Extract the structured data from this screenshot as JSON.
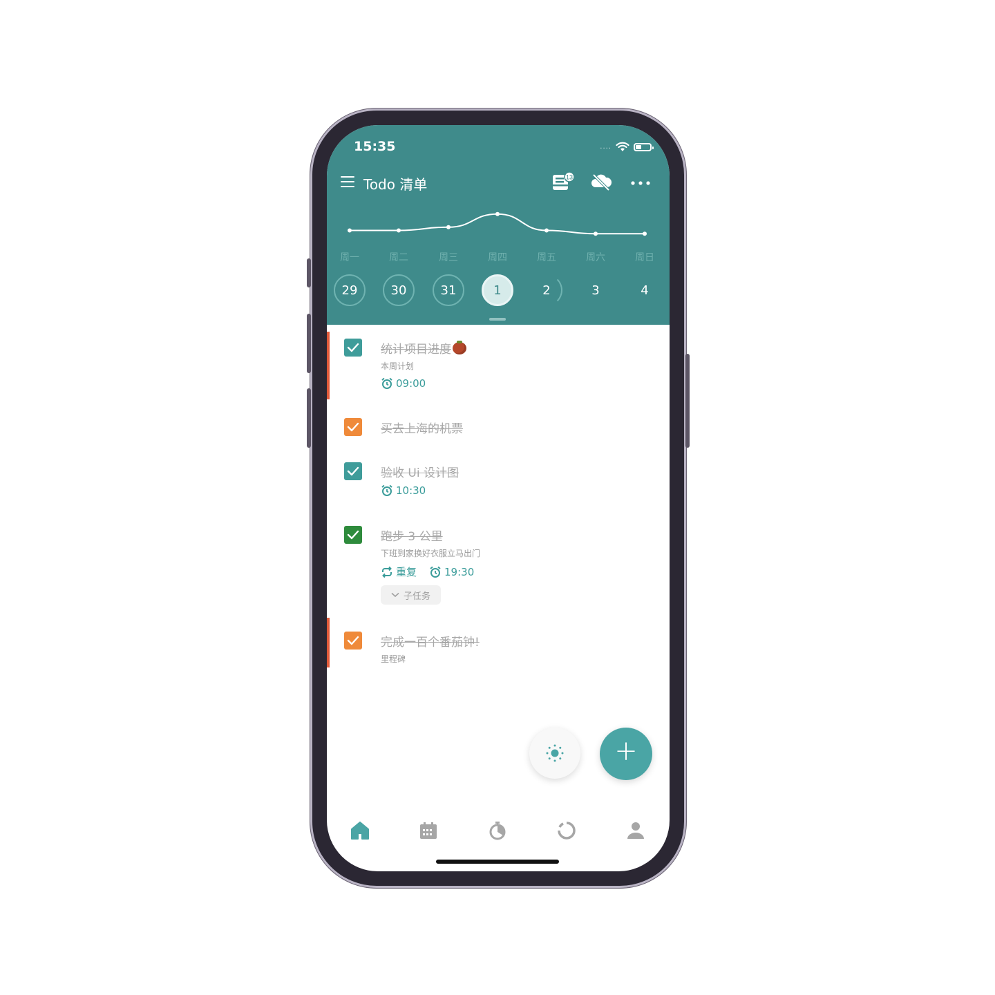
{
  "status": {
    "time": "15:35"
  },
  "toolbar": {
    "title": "Todo 清单",
    "badge": "13"
  },
  "week": {
    "days": [
      "周一",
      "周二",
      "周三",
      "周四",
      "周五",
      "周六",
      "周日"
    ],
    "dates": [
      "29",
      "30",
      "31",
      "1",
      "2",
      "3",
      "4"
    ],
    "today_index": 3
  },
  "chart_data": {
    "type": "line",
    "categories": [
      "周一",
      "周二",
      "周三",
      "周四",
      "周五",
      "周六",
      "周日"
    ],
    "values": [
      1,
      1,
      1.5,
      3.5,
      1,
      0.5,
      0.5
    ]
  },
  "tasks": [
    {
      "title": "统计项目进度",
      "subtitle": "本周计划",
      "time": "09:00",
      "color": "#3f9c9a",
      "accent": true
    },
    {
      "title": "买去上海的机票",
      "color": "#ef8a3a",
      "accent": false
    },
    {
      "title": "验收 Ui 设计图",
      "time": "10:30",
      "color": "#3f9c9a",
      "accent": false
    },
    {
      "title": "跑步 3 公里",
      "subtitle": "下班到家换好衣服立马出门",
      "repeat": "重复",
      "time": "19:30",
      "subtask": "子任务",
      "color": "#2e8b3c",
      "accent": false
    },
    {
      "title": "完成一百个番茄钟!",
      "subtitle": "里程碑",
      "color": "#ef8a3a",
      "accent": true
    }
  ],
  "colors": {
    "header": "#3f8b8b",
    "accent_red": "#e25a3a",
    "teal": "#4aa5a5"
  }
}
